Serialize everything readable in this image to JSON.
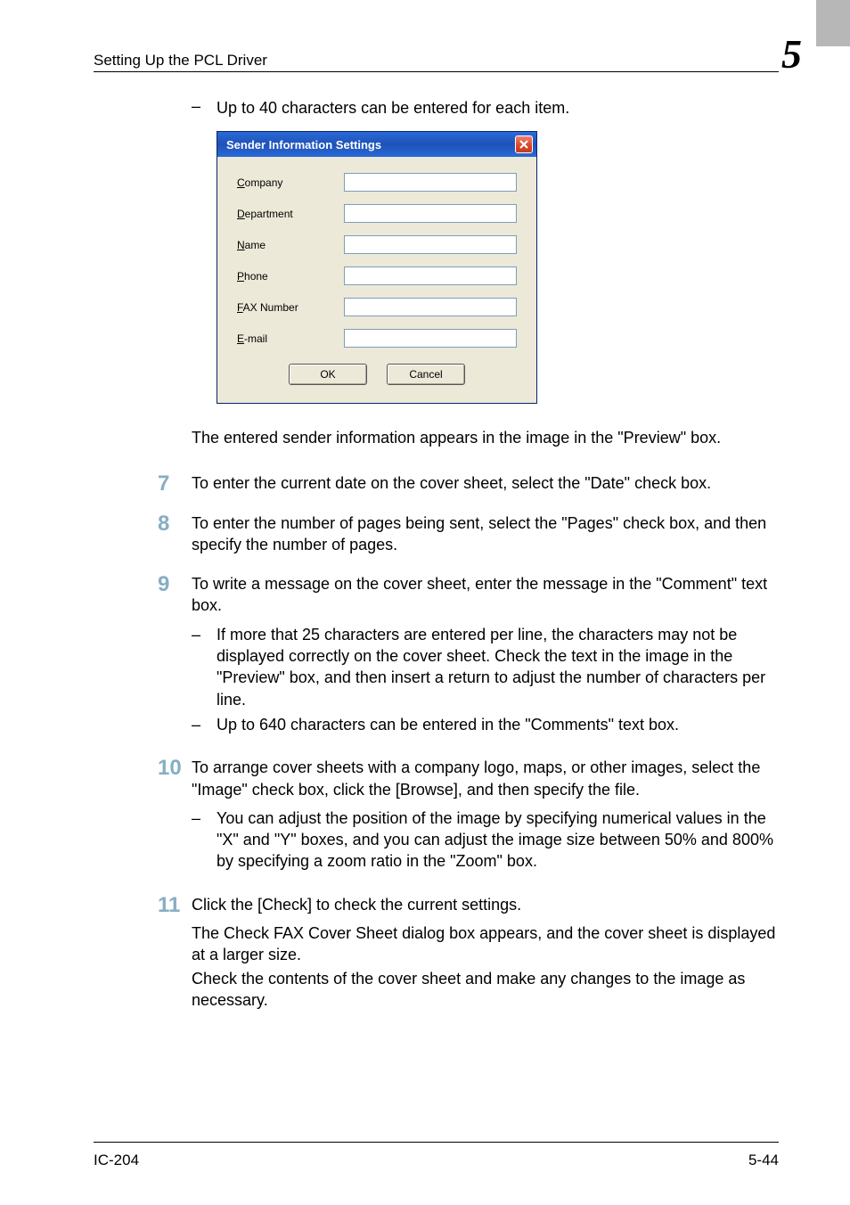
{
  "header": {
    "title": "Setting Up the PCL Driver",
    "chapter": "5"
  },
  "intro_bullet": "Up to 40 characters can be entered for each item.",
  "dialog": {
    "title": "Sender Information Settings",
    "fields": {
      "company": {
        "label_pre": "C",
        "label_rest": "ompany",
        "value": ""
      },
      "department": {
        "label_pre": "D",
        "label_rest": "epartment",
        "value": ""
      },
      "name": {
        "label_pre": "N",
        "label_rest": "ame",
        "value": ""
      },
      "phone": {
        "label_pre": "P",
        "label_rest": "hone",
        "value": ""
      },
      "fax": {
        "label_pre": "F",
        "label_rest": "AX Number",
        "value": ""
      },
      "email": {
        "label_pre": "E",
        "label_rest": "-mail",
        "value": ""
      }
    },
    "ok_label": "OK",
    "cancel_label": "Cancel"
  },
  "after_dialog_para": "The entered sender information appears in the image in the \"Preview\" box.",
  "steps": {
    "s7": {
      "num": "7",
      "text": "To enter the current date on the cover sheet, select the \"Date\" check box."
    },
    "s8": {
      "num": "8",
      "text": "To enter the number of pages being sent, select the \"Pages\" check box, and then specify the number of pages."
    },
    "s9": {
      "num": "9",
      "text": "To write a message on the cover sheet, enter the message in the \"Comment\" text box.",
      "bullets": [
        "If more that 25 characters are entered per line, the characters may not be displayed correctly on the cover sheet. Check the text in the image in the \"Preview\" box, and then insert a return to adjust the number of characters per line.",
        "Up to 640 characters can be entered in the \"Comments\" text box."
      ]
    },
    "s10": {
      "num": "10",
      "text": "To arrange cover sheets with a company logo, maps, or other images, select the \"Image\" check box, click the [Browse], and then specify the file.",
      "bullets": [
        "You can adjust the position of the image by specifying numerical values in the \"X\" and \"Y\" boxes, and you can adjust the image size between 50% and 800% by specifying a zoom ratio in the \"Zoom\" box."
      ]
    },
    "s11": {
      "num": "11",
      "text": "Click the [Check] to check the current settings.",
      "follow1": "The Check FAX Cover Sheet dialog box appears, and the cover sheet is displayed at a larger size.",
      "follow2": "Check the contents of the cover sheet and make any changes to the image as necessary."
    }
  },
  "footer": {
    "left": "IC-204",
    "right": "5-44"
  }
}
